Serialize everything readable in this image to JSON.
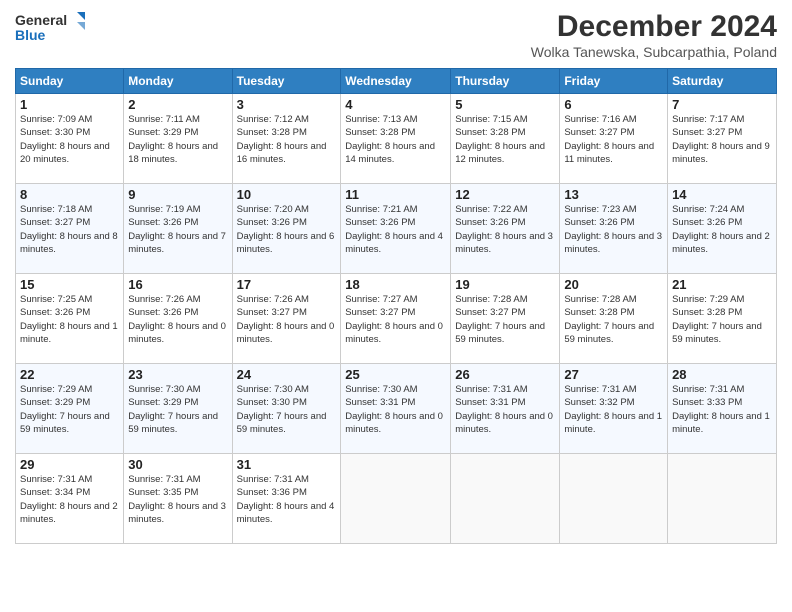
{
  "header": {
    "logo_general": "General",
    "logo_blue": "Blue",
    "title": "December 2024",
    "subtitle": "Wolka Tanewska, Subcarpathia, Poland"
  },
  "calendar": {
    "weekdays": [
      "Sunday",
      "Monday",
      "Tuesday",
      "Wednesday",
      "Thursday",
      "Friday",
      "Saturday"
    ],
    "weeks": [
      [
        {
          "day": "1",
          "sunrise": "7:09 AM",
          "sunset": "3:30 PM",
          "daylight": "8 hours and 20 minutes."
        },
        {
          "day": "2",
          "sunrise": "7:11 AM",
          "sunset": "3:29 PM",
          "daylight": "8 hours and 18 minutes."
        },
        {
          "day": "3",
          "sunrise": "7:12 AM",
          "sunset": "3:28 PM",
          "daylight": "8 hours and 16 minutes."
        },
        {
          "day": "4",
          "sunrise": "7:13 AM",
          "sunset": "3:28 PM",
          "daylight": "8 hours and 14 minutes."
        },
        {
          "day": "5",
          "sunrise": "7:15 AM",
          "sunset": "3:28 PM",
          "daylight": "8 hours and 12 minutes."
        },
        {
          "day": "6",
          "sunrise": "7:16 AM",
          "sunset": "3:27 PM",
          "daylight": "8 hours and 11 minutes."
        },
        {
          "day": "7",
          "sunrise": "7:17 AM",
          "sunset": "3:27 PM",
          "daylight": "8 hours and 9 minutes."
        }
      ],
      [
        {
          "day": "8",
          "sunrise": "7:18 AM",
          "sunset": "3:27 PM",
          "daylight": "8 hours and 8 minutes."
        },
        {
          "day": "9",
          "sunrise": "7:19 AM",
          "sunset": "3:26 PM",
          "daylight": "8 hours and 7 minutes."
        },
        {
          "day": "10",
          "sunrise": "7:20 AM",
          "sunset": "3:26 PM",
          "daylight": "8 hours and 6 minutes."
        },
        {
          "day": "11",
          "sunrise": "7:21 AM",
          "sunset": "3:26 PM",
          "daylight": "8 hours and 4 minutes."
        },
        {
          "day": "12",
          "sunrise": "7:22 AM",
          "sunset": "3:26 PM",
          "daylight": "8 hours and 3 minutes."
        },
        {
          "day": "13",
          "sunrise": "7:23 AM",
          "sunset": "3:26 PM",
          "daylight": "8 hours and 3 minutes."
        },
        {
          "day": "14",
          "sunrise": "7:24 AM",
          "sunset": "3:26 PM",
          "daylight": "8 hours and 2 minutes."
        }
      ],
      [
        {
          "day": "15",
          "sunrise": "7:25 AM",
          "sunset": "3:26 PM",
          "daylight": "8 hours and 1 minute."
        },
        {
          "day": "16",
          "sunrise": "7:26 AM",
          "sunset": "3:26 PM",
          "daylight": "8 hours and 0 minutes."
        },
        {
          "day": "17",
          "sunrise": "7:26 AM",
          "sunset": "3:27 PM",
          "daylight": "8 hours and 0 minutes."
        },
        {
          "day": "18",
          "sunrise": "7:27 AM",
          "sunset": "3:27 PM",
          "daylight": "8 hours and 0 minutes."
        },
        {
          "day": "19",
          "sunrise": "7:28 AM",
          "sunset": "3:27 PM",
          "daylight": "7 hours and 59 minutes."
        },
        {
          "day": "20",
          "sunrise": "7:28 AM",
          "sunset": "3:28 PM",
          "daylight": "7 hours and 59 minutes."
        },
        {
          "day": "21",
          "sunrise": "7:29 AM",
          "sunset": "3:28 PM",
          "daylight": "7 hours and 59 minutes."
        }
      ],
      [
        {
          "day": "22",
          "sunrise": "7:29 AM",
          "sunset": "3:29 PM",
          "daylight": "7 hours and 59 minutes."
        },
        {
          "day": "23",
          "sunrise": "7:30 AM",
          "sunset": "3:29 PM",
          "daylight": "7 hours and 59 minutes."
        },
        {
          "day": "24",
          "sunrise": "7:30 AM",
          "sunset": "3:30 PM",
          "daylight": "7 hours and 59 minutes."
        },
        {
          "day": "25",
          "sunrise": "7:30 AM",
          "sunset": "3:31 PM",
          "daylight": "8 hours and 0 minutes."
        },
        {
          "day": "26",
          "sunrise": "7:31 AM",
          "sunset": "3:31 PM",
          "daylight": "8 hours and 0 minutes."
        },
        {
          "day": "27",
          "sunrise": "7:31 AM",
          "sunset": "3:32 PM",
          "daylight": "8 hours and 1 minute."
        },
        {
          "day": "28",
          "sunrise": "7:31 AM",
          "sunset": "3:33 PM",
          "daylight": "8 hours and 1 minute."
        }
      ],
      [
        {
          "day": "29",
          "sunrise": "7:31 AM",
          "sunset": "3:34 PM",
          "daylight": "8 hours and 2 minutes."
        },
        {
          "day": "30",
          "sunrise": "7:31 AM",
          "sunset": "3:35 PM",
          "daylight": "8 hours and 3 minutes."
        },
        {
          "day": "31",
          "sunrise": "7:31 AM",
          "sunset": "3:36 PM",
          "daylight": "8 hours and 4 minutes."
        },
        null,
        null,
        null,
        null
      ]
    ]
  }
}
